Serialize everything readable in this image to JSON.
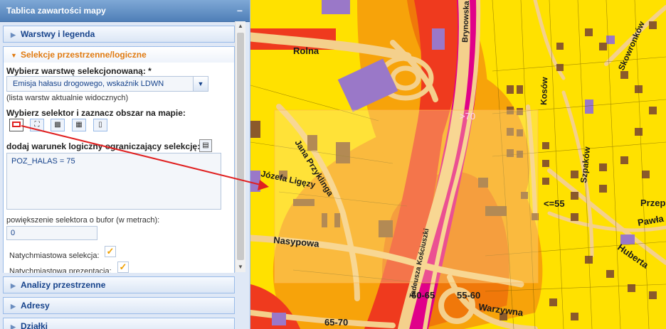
{
  "panel": {
    "title": "Tablica zawartości mapy",
    "collapse_glyph": "−",
    "accordion": [
      {
        "label": "Warstwy i legenda",
        "expanded": false
      },
      {
        "label": "Selekcje przestrzenne/logiczne",
        "expanded": true
      },
      {
        "label": "Analizy przestrzenne",
        "expanded": false
      },
      {
        "label": "Adresy",
        "expanded": false
      },
      {
        "label": "Działki",
        "expanded": false
      }
    ]
  },
  "selection": {
    "layer_label": "Wybierz warstwę selekcjonowaną: *",
    "layer_value": "Emisja hałasu drogowego, wskaźnik LDWN",
    "layer_hint": "(lista warstw aktualnie widocznych)",
    "selector_label": "Wybierz selektor i zaznacz obszar na mapie:",
    "selector_tools": [
      "rectangle-selector-icon",
      "polygon-selector-icon",
      "circle-selector-icon",
      "line-selector-icon",
      "point-selector-icon"
    ],
    "condition_label": "dodaj warunek logiczny ograniczający selekcję:",
    "condition_value": "POZ_HALAS = 75",
    "buffer_label": "powiększenie selektora o bufor (w metrach):",
    "buffer_value": "0",
    "instant_selection_label": "Natychmiastowa selekcja:",
    "instant_selection_checked": true,
    "instant_presentation_label": "Natychmiastowa prezentacja:",
    "instant_presentation_checked": true
  },
  "map": {
    "streets": {
      "rolna": "Rolna",
      "brynowska": "Brynowska",
      "jana_przyklinga": "Jana Przyklinga",
      "jozefa_ligezy": "Józefa Ligęzy",
      "nasypowa": "Nasypowa",
      "tadeusza_koscius": "Tadeusza Kościuszki",
      "kosow": "Kosów",
      "szpakow": "Szpaków",
      "skowronkow": "Skowronków",
      "przep": "Przep",
      "pawla": "Pawła",
      "huberta": "Huberta",
      "warzywna": "Warzywna"
    },
    "noise_labels": {
      "gt70": ">70",
      "le55": "<=55",
      "r60_65": "60-65",
      "r55_60": "55-60",
      "r65_70": "65-70"
    },
    "colors": {
      "zone_lt55": "#ffe100",
      "zone_55_60": "#f7a30a",
      "zone_60_65": "#f0780a",
      "zone_65_70": "#ef3a1e",
      "zone_gt70": "#e0008a",
      "road": "#f4d08c",
      "building": "#8b5a2b",
      "building_public": "#9a78c8"
    }
  }
}
